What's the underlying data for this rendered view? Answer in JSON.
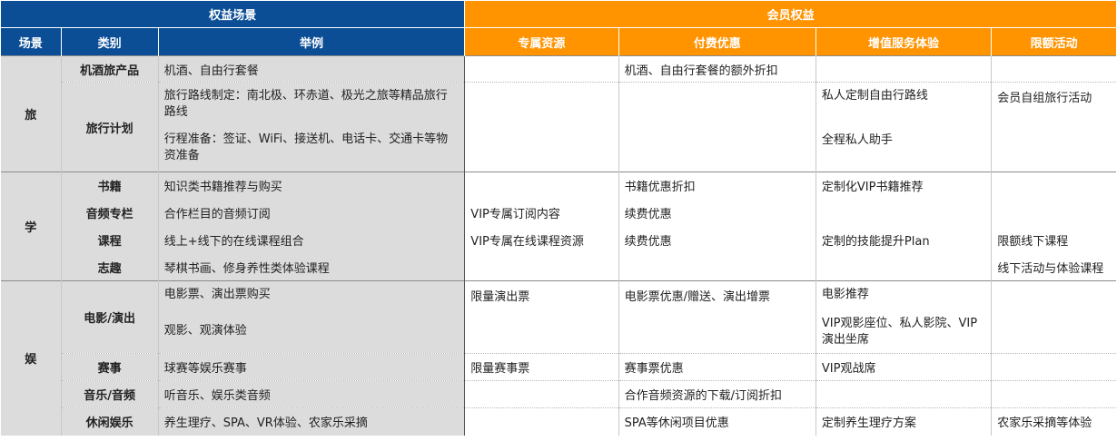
{
  "headers": {
    "group_left": "权益场景",
    "group_right": "会员权益",
    "scene": "场景",
    "category": "类别",
    "example": "举例",
    "exclusive": "专属资源",
    "discount": "付费优惠",
    "value_service": "增值服务体验",
    "limited": "限额活动"
  },
  "travel": {
    "scene": "旅",
    "r1": {
      "category": "机酒旅产品",
      "example": "机酒、自由行套餐",
      "exclusive": "",
      "discount": "机酒、自由行套餐的额外折扣",
      "value_service": "",
      "limited": ""
    },
    "r2": {
      "category": "旅行计划",
      "example_1": "旅行路线制定：南北极、环赤道、极光之旅等精品旅行路线",
      "example_2": "行程准备：签证、WiFi、接送机、电话卡、交通卡等物资准备",
      "value_service_1": "私人定制自由行路线",
      "value_service_2": "全程私人助手",
      "limited": "会员自组旅行活动"
    }
  },
  "study": {
    "scene": "学",
    "rows": [
      {
        "category": "书籍",
        "example": "知识类书籍推荐与购买",
        "exclusive": "",
        "discount": "书籍优惠折扣",
        "value_service": "定制化VIP书籍推荐",
        "limited": ""
      },
      {
        "category": "音频专栏",
        "example": "合作栏目的音频订阅",
        "exclusive": "VIP专属订阅内容",
        "discount": "续费优惠",
        "value_service": "",
        "limited": ""
      },
      {
        "category": "课程",
        "example": "线上+线下的在线课程组合",
        "exclusive": "VIP专属在线课程资源",
        "discount": "续费优惠",
        "value_service": "定制的技能提升Plan",
        "limited": "限额线下课程"
      },
      {
        "category": "志趣",
        "example": "琴棋书画、修身养性类体验课程",
        "exclusive": "",
        "discount": "",
        "value_service": "",
        "limited": "线下活动与体验课程"
      }
    ]
  },
  "ent": {
    "scene": "娱",
    "movie": {
      "category": "电影/演出",
      "example_1": "电影票、演出票购买",
      "example_2": "观影、观演体验",
      "exclusive": "限量演出票",
      "discount": "电影票优惠/赠送、演出增票",
      "value_service_1": "电影推荐",
      "value_service_2": "VIP观影座位、私人影院、VIP演出坐席"
    },
    "rows": [
      {
        "category": "赛事",
        "example": "球赛等娱乐赛事",
        "exclusive": "限量赛事票",
        "discount": "赛事票优惠",
        "value_service": "VIP观战席",
        "limited": ""
      },
      {
        "category": "音乐/音频",
        "example": "听音乐、娱乐类音频",
        "exclusive": "",
        "discount": "合作音频资源的下载/订阅折扣",
        "value_service": "",
        "limited": ""
      },
      {
        "category": "休闲娱乐",
        "example": "养生理疗、SPA、VR体验、农家乐采摘",
        "exclusive": "",
        "discount": "SPA等休闲项目优惠",
        "value_service": "定制养生理疗方案",
        "limited": "农家乐采摘等体验"
      }
    ]
  }
}
